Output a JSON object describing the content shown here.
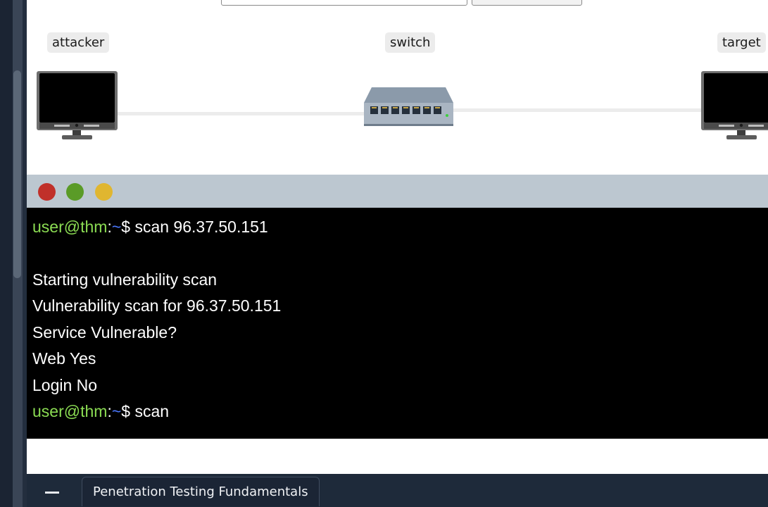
{
  "network": {
    "nodes": [
      {
        "label": "attacker",
        "icon": "monitor-icon"
      },
      {
        "label": "switch",
        "icon": "network-switch-icon"
      },
      {
        "label": "target",
        "icon": "monitor-icon"
      }
    ]
  },
  "terminal": {
    "prompt_user": "user@thm",
    "prompt_colon": ":",
    "prompt_path": "~",
    "prompt_symbol": "$",
    "command_1": " scan 96.37.50.151",
    "output": [
      "Starting vulnerability scan",
      "Vulnerability scan for 96.37.50.151",
      "Service Vulnerable?",
      "Web Yes",
      "Login No"
    ],
    "command_2": " scan"
  },
  "taskbar": {
    "tab_label": "Penetration Testing Fundamentals"
  },
  "colors": {
    "prompt_user": "#8bdc53",
    "prompt_path": "#4a78ff",
    "terminal_bg": "#000000",
    "titlebar_bg": "#bcc7d0",
    "dot_close": "#c0302a",
    "dot_maximize": "#5a9b27",
    "dot_minimize": "#e0b630"
  }
}
